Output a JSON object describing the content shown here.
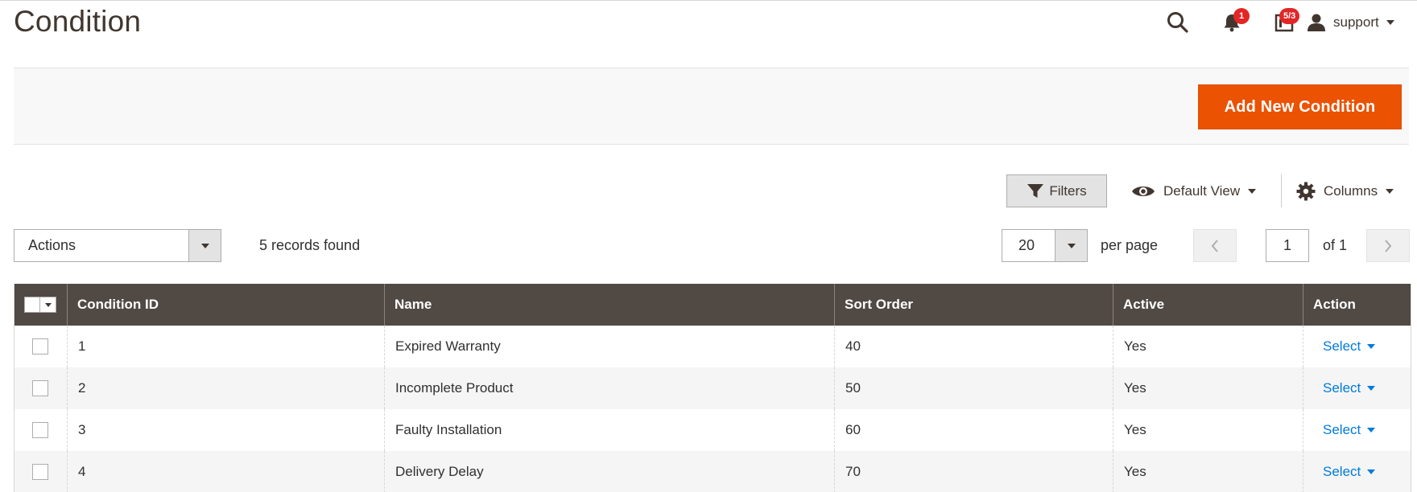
{
  "page": {
    "title": "Condition"
  },
  "header": {
    "notifications_count": "1",
    "system_messages_count": "5/3",
    "user_name": "support",
    "search_icon": "search-icon",
    "bell_icon": "bell-icon",
    "messages_icon": "system-messages-icon",
    "user_icon": "user-icon"
  },
  "action_bar": {
    "add_button_label": "Add New Condition"
  },
  "toolbar": {
    "filters_label": "Filters",
    "view_label": "Default View",
    "columns_label": "Columns"
  },
  "grid_controls": {
    "mass_actions_label": "Actions",
    "records_found": "5 records found",
    "per_page_value": "20",
    "per_page_label": "per page",
    "current_page": "1",
    "page_total_label": "of 1"
  },
  "table": {
    "columns": [
      "Condition ID",
      "Name",
      "Sort Order",
      "Active",
      "Action"
    ],
    "rows": [
      {
        "id": "1",
        "name": "Expired Warranty",
        "sort_order": "40",
        "active": "Yes",
        "action": "Select"
      },
      {
        "id": "2",
        "name": "Incomplete Product",
        "sort_order": "50",
        "active": "Yes",
        "action": "Select"
      },
      {
        "id": "3",
        "name": "Faulty Installation",
        "sort_order": "60",
        "active": "Yes",
        "action": "Select"
      },
      {
        "id": "4",
        "name": "Delivery Delay",
        "sort_order": "70",
        "active": "Yes",
        "action": "Select"
      }
    ]
  },
  "colors": {
    "accent": "#eb5202",
    "header_bg": "#514943",
    "link": "#007bdb",
    "badge": "#e22626"
  }
}
